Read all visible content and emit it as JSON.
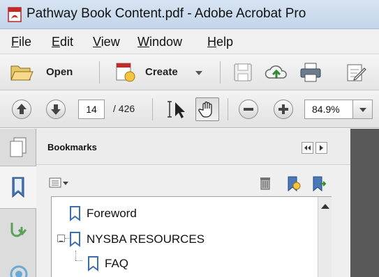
{
  "window": {
    "title": "Pathway Book Content.pdf - Adobe Acrobat Pro"
  },
  "menu": {
    "items": [
      {
        "label": "File",
        "u": "F",
        "rest": "ile"
      },
      {
        "label": "Edit",
        "u": "E",
        "rest": "dit"
      },
      {
        "label": "View",
        "u": "V",
        "rest": "iew"
      },
      {
        "label": "Window",
        "u": "W",
        "rest": "indow"
      },
      {
        "label": "Help",
        "u": "H",
        "rest": "elp"
      }
    ]
  },
  "toolbar": {
    "open_label": "Open",
    "create_label": "Create"
  },
  "nav": {
    "current_page": "14",
    "total_pages": "/ 426",
    "zoom": "84.9%"
  },
  "bookmarks": {
    "title": "Bookmarks",
    "items": [
      {
        "label": "Foreword"
      },
      {
        "label": "NYSBA RESOURCES"
      },
      {
        "label": "FAQ"
      }
    ]
  },
  "icons": [
    "pdf-app-icon",
    "folder-open-icon",
    "create-pdf-icon",
    "save-icon",
    "cloud-upload-icon",
    "print-icon",
    "edit-sign-icon",
    "page-up-icon",
    "page-down-icon",
    "select-text-icon",
    "hand-tool-icon",
    "zoom-out-icon",
    "zoom-in-icon",
    "chevron-down-icon",
    "pages-icon",
    "bookmark-icon",
    "signatures-icon",
    "layers-icon",
    "options-icon",
    "trash-icon",
    "new-bookmark-icon",
    "expand-bookmark-icon",
    "collapse-icon",
    "scroll-up-icon"
  ],
  "colors": {
    "accent": "#4a78b8",
    "bookmark_blue": "#3a6fb5",
    "doc_bg": "#595959"
  }
}
